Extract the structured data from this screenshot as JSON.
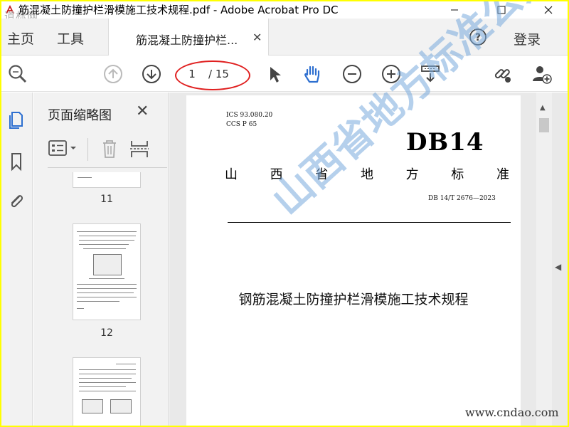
{
  "window": {
    "title": "筋混凝土防撞护栏滑模施工技术规程.pdf - Adobe Acrobat Pro DC",
    "watermark_top": "道标网"
  },
  "tabs": {
    "home": "主页",
    "tools": "工具",
    "doc_tab": "筋混凝土防撞护栏...",
    "login": "登录"
  },
  "toolbar": {
    "page_current": "1",
    "page_total": "/ 15"
  },
  "thumbnails_panel": {
    "title": "页面缩略图",
    "pages": [
      {
        "label": "11"
      },
      {
        "label": "12"
      }
    ]
  },
  "document_page": {
    "ics": "ICS  93.080.20",
    "ccs": "CCS  P 65",
    "db_mark": "DB14",
    "province": [
      "山",
      "西",
      "省",
      "地",
      "方",
      "标",
      "准"
    ],
    "std_number": "DB 14/T 2676—2023",
    "title": "钢筋混凝土防撞护栏滑模施工技术规程"
  },
  "overlays": {
    "diagonal_watermark": "山西省地方标准公开",
    "site": "www.cndao.com"
  },
  "colors": {
    "frame": "#ffff00",
    "accent": "#2d6fd0",
    "highlight_circle": "#e02020"
  }
}
